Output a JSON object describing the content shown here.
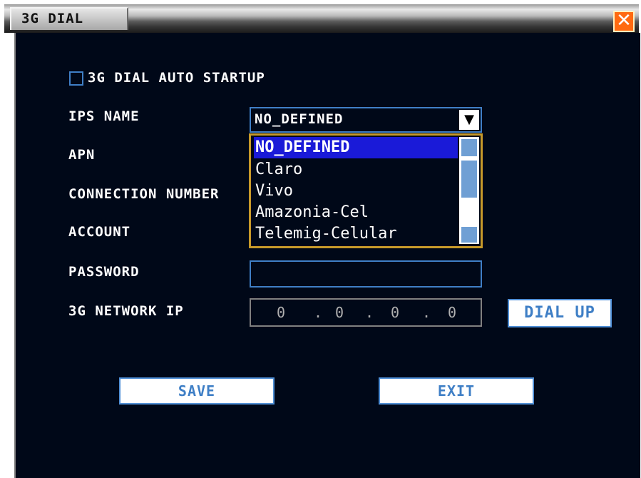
{
  "window": {
    "title": "3G DIAL",
    "close_icon": "close-icon"
  },
  "auto_startup": {
    "label": "3G DIAL AUTO STARTUP",
    "checked": false
  },
  "labels": {
    "ips_name": "IPS NAME",
    "apn": "APN",
    "connection_number": "CONNECTION NUMBER",
    "account": "ACCOUNT",
    "password": "PASSWORD",
    "network_ip": "3G NETWORK IP"
  },
  "ips_select": {
    "value": "NO_DEFINED",
    "options": [
      "NO_DEFINED",
      "Claro",
      "Vivo",
      "Amazonia-Cel",
      "Telemig-Celular"
    ],
    "selected_index": 0
  },
  "password": {
    "value": ""
  },
  "network_ip": {
    "octets": [
      "0",
      "0",
      "0",
      "0"
    ]
  },
  "buttons": {
    "dial_up": "DIAL UP",
    "save": "SAVE",
    "exit": "EXIT"
  },
  "colors": {
    "panel_bg": "#000818",
    "field_border": "#3f7fc6",
    "dropdown_border": "#c79a2a",
    "selection": "#1a1ad8",
    "close_button": "#ff6a10"
  }
}
